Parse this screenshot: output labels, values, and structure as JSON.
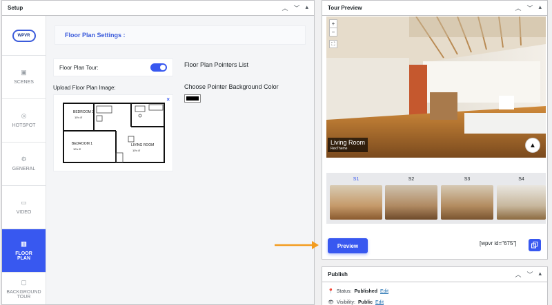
{
  "setup": {
    "title": "Setup",
    "logo": "WPVR",
    "nav": [
      {
        "label": "SCENES",
        "icon": "scenes-icon"
      },
      {
        "label": "HOTSPOT",
        "icon": "hotspot-icon"
      },
      {
        "label": "GENERAL",
        "icon": "gear-icon"
      },
      {
        "label": "VIDEO",
        "icon": "video-icon"
      },
      {
        "label_line1": "FLOOR",
        "label_line2": "PLAN",
        "icon": "map-icon",
        "active": true
      },
      {
        "label_line1": "BACKGROUND",
        "label_line2": "TOUR",
        "icon": "background-icon"
      }
    ],
    "settings_title": "Floor Plan Settings :",
    "tour_label": "Floor Plan Tour:",
    "tour_enabled": true,
    "upload_label": "Upload Floor Plan Image:",
    "pointers_label": "Floor Plan Pointers List",
    "pointer_bg_label": "Choose Pointer Background Color",
    "pointer_bg_color": "#000000",
    "plan": {
      "bedroom2": "BEDROOM 2",
      "bedroom2_dims": "10'x 8'",
      "bedroom1": "BEDROOM 1",
      "bedroom1_dims": "10'x 8'",
      "living": "LIVING ROOM",
      "living_dims": "10'x 8'",
      "close": "×"
    }
  },
  "tour": {
    "title": "Tour Preview",
    "zoom_in": "+",
    "zoom_out": "−",
    "scene_title": "Living Room",
    "scene_subtitle": "RexTheme",
    "scenes": [
      "S1",
      "S2",
      "S3",
      "S4"
    ],
    "active_scene": "S1",
    "preview_label": "Preview",
    "shortcode": "[wpvr id=\"675\"]"
  },
  "publish": {
    "title": "Publish",
    "status_label": "Status:",
    "status_value": "Published",
    "status_edit": "Edit",
    "visibility_label": "Visibility:",
    "visibility_value": "Public",
    "visibility_edit": "Edit"
  },
  "colors": {
    "accent": "#3858f0",
    "arrow": "#f39c1f"
  }
}
